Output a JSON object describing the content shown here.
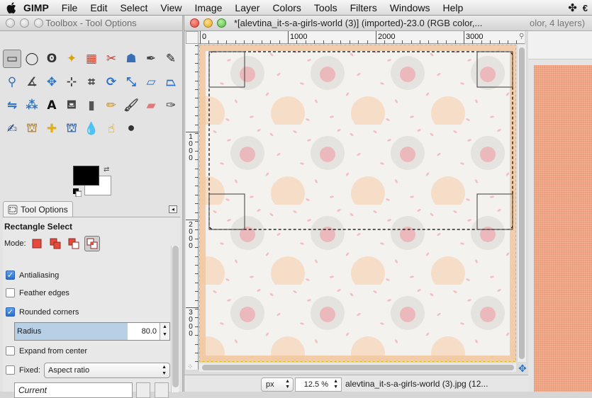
{
  "menubar": {
    "app_name": "GIMP",
    "items": [
      "File",
      "Edit",
      "Select",
      "View",
      "Image",
      "Layer",
      "Colors",
      "Tools",
      "Filters",
      "Windows",
      "Help"
    ]
  },
  "toolbox": {
    "title": "Toolbox - Tool Options",
    "tools": [
      {
        "name": "rectangle-select-icon",
        "glyph": "▭",
        "color": "#333333"
      },
      {
        "name": "ellipse-select-icon",
        "glyph": "◯",
        "color": "#333333"
      },
      {
        "name": "free-select-icon",
        "glyph": "ʘ",
        "color": "#333333"
      },
      {
        "name": "fuzzy-select-icon",
        "glyph": "✦",
        "color": "#d9a400"
      },
      {
        "name": "select-by-color-icon",
        "glyph": "▦",
        "color": "#d2432c"
      },
      {
        "name": "scissors-select-icon",
        "glyph": "✂",
        "color": "#c0392b"
      },
      {
        "name": "foreground-select-icon",
        "glyph": "☗",
        "color": "#3b6fb5"
      },
      {
        "name": "paths-icon",
        "glyph": "✒",
        "color": "#444444"
      },
      {
        "name": "color-picker-icon",
        "glyph": "✎",
        "color": "#222222"
      },
      {
        "name": "zoom-icon",
        "glyph": "⚲",
        "color": "#3b6fb5"
      },
      {
        "name": "measure-icon",
        "glyph": "∡",
        "color": "#444444"
      },
      {
        "name": "move-icon",
        "glyph": "✥",
        "color": "#2a72c4"
      },
      {
        "name": "alignment-icon",
        "glyph": "⊹",
        "color": "#444444"
      },
      {
        "name": "crop-icon",
        "glyph": "⌗",
        "color": "#444444"
      },
      {
        "name": "rotate-icon",
        "glyph": "⟳",
        "color": "#2a72c4"
      },
      {
        "name": "scale-icon",
        "glyph": "⤡",
        "color": "#2a72c4"
      },
      {
        "name": "shear-icon",
        "glyph": "▱",
        "color": "#2a72c4"
      },
      {
        "name": "perspective-icon",
        "glyph": "⏢",
        "color": "#2a72c4"
      },
      {
        "name": "flip-icon",
        "glyph": "⇋",
        "color": "#2a72c4"
      },
      {
        "name": "cage-transform-icon",
        "glyph": "⁂",
        "color": "#2a72c4"
      },
      {
        "name": "text-icon",
        "glyph": "A",
        "color": "#111111"
      },
      {
        "name": "bucket-fill-icon",
        "glyph": "⛾",
        "color": "#444444"
      },
      {
        "name": "blend-icon",
        "glyph": "▮",
        "color": "#555555"
      },
      {
        "name": "pencil-icon",
        "glyph": "✏",
        "color": "#c58a1f"
      },
      {
        "name": "paintbrush-icon",
        "glyph": "🖌",
        "color": "#444444"
      },
      {
        "name": "eraser-icon",
        "glyph": "▰",
        "color": "#e07a7a"
      },
      {
        "name": "airbrush-icon",
        "glyph": "✑",
        "color": "#444444"
      },
      {
        "name": "ink-icon",
        "glyph": "✍",
        "color": "#1f3f73"
      },
      {
        "name": "clone-icon",
        "glyph": "⛫",
        "color": "#b58a3a"
      },
      {
        "name": "heal-icon",
        "glyph": "✚",
        "color": "#e0b020"
      },
      {
        "name": "perspective-clone-icon",
        "glyph": "⛫",
        "color": "#3b6fb5"
      },
      {
        "name": "blur-sharpen-icon",
        "glyph": "💧",
        "color": "#3b6fb5"
      },
      {
        "name": "smudge-icon",
        "glyph": "☝",
        "color": "#c58a1f"
      },
      {
        "name": "dodge-burn-icon",
        "glyph": "⚫",
        "color": "#333333"
      }
    ],
    "colors": {
      "foreground": "#000000",
      "background": "#ffffff"
    },
    "dock_tab": "Tool Options",
    "options": {
      "title": "Rectangle Select",
      "mode_label": "Mode:",
      "antialiasing": {
        "label": "Antialiasing",
        "checked": true
      },
      "feather": {
        "label": "Feather edges",
        "checked": false
      },
      "rounded": {
        "label": "Rounded corners",
        "checked": true
      },
      "radius": {
        "label": "Radius",
        "value": "80.0",
        "fill": 0.73
      },
      "expand": {
        "label": "Expand from center",
        "checked": false
      },
      "fixed": {
        "label": "Fixed:",
        "checked": false,
        "select": "Aspect ratio"
      },
      "current": "Current"
    }
  },
  "image_window": {
    "title": "*[alevtina_it-s-a-girls-world (3)] (imported)-23.0 (RGB color,...",
    "ruler_h": [
      "0",
      "1000",
      "2000",
      "3000"
    ],
    "ruler_v": [
      "1000",
      "2000",
      "3000"
    ],
    "status": {
      "unit": "px",
      "zoom": "12.5 %",
      "text": "alevtina_it-s-a-girls-world (3).jpg (12..."
    }
  },
  "back_window": {
    "title": "olor, 4 layers)"
  }
}
